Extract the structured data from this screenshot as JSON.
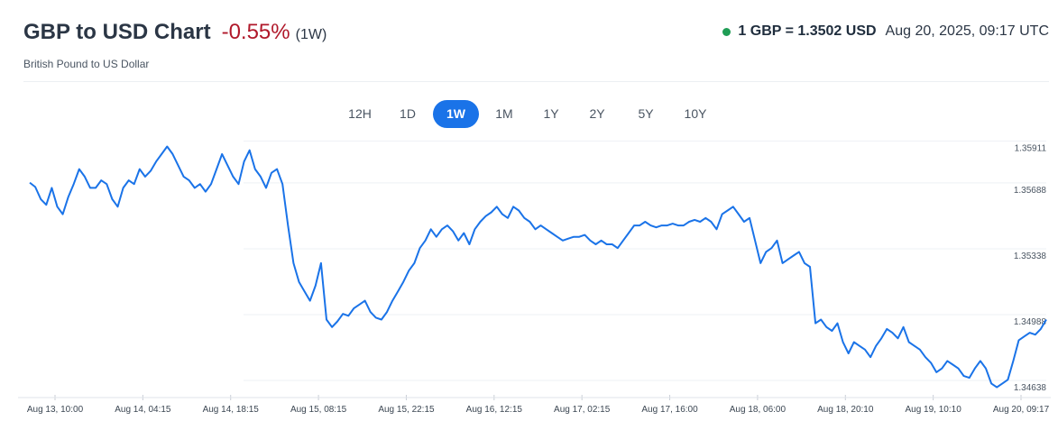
{
  "header": {
    "title": "GBP to USD Chart",
    "change": "-0.55%",
    "period": "(1W)",
    "subtitle": "British Pound to US Dollar",
    "rate": "1 GBP = 1.3502 USD",
    "timestamp": "Aug 20, 2025, 09:17 UTC",
    "status_color": "#1f9d55"
  },
  "tabs": [
    {
      "label": "12H",
      "active": false
    },
    {
      "label": "1D",
      "active": false
    },
    {
      "label": "1W",
      "active": true
    },
    {
      "label": "1M",
      "active": false
    },
    {
      "label": "1Y",
      "active": false
    },
    {
      "label": "2Y",
      "active": false
    },
    {
      "label": "5Y",
      "active": false
    },
    {
      "label": "10Y",
      "active": false
    }
  ],
  "chart_data": {
    "type": "line",
    "line_color": "#1a73e8",
    "y_ticks": [
      "1.35911",
      "1.35688",
      "1.35338",
      "1.34988",
      "1.34638"
    ],
    "y_tick_values": [
      1.35911,
      1.35688,
      1.35338,
      1.34988,
      1.34638
    ],
    "x_ticks": [
      "Aug 13, 10:00",
      "Aug 14, 04:15",
      "Aug 14, 18:15",
      "Aug 15, 08:15",
      "Aug 15, 22:15",
      "Aug 16, 12:15",
      "Aug 17, 02:15",
      "Aug 17, 16:00",
      "Aug 18, 06:00",
      "Aug 18, 20:10",
      "Aug 19, 10:10",
      "Aug 20, 09:17"
    ],
    "ylim": [
      1.3459,
      1.3598
    ],
    "series": [
      {
        "values": [
          1.35728,
          1.35705,
          1.3564,
          1.3561,
          1.357,
          1.356,
          1.3556,
          1.3565,
          1.3572,
          1.358,
          1.3576,
          1.357,
          1.357,
          1.3574,
          1.3572,
          1.3564,
          1.356,
          1.357,
          1.3574,
          1.3572,
          1.358,
          1.3576,
          1.3579,
          1.3584,
          1.3588,
          1.3592,
          1.3588,
          1.3582,
          1.3576,
          1.3574,
          1.357,
          1.3572,
          1.3568,
          1.3572,
          1.358,
          1.3588,
          1.3582,
          1.3576,
          1.3572,
          1.3584,
          1.359,
          1.358,
          1.3576,
          1.357,
          1.3578,
          1.358,
          1.3572,
          1.355,
          1.353,
          1.352,
          1.3515,
          1.351,
          1.3518,
          1.353,
          1.35,
          1.3496,
          1.3499,
          1.3503,
          1.3502,
          1.3506,
          1.3508,
          1.351,
          1.3504,
          1.3501,
          1.35,
          1.3504,
          1.351,
          1.3515,
          1.352,
          1.3526,
          1.353,
          1.3538,
          1.3542,
          1.3548,
          1.3544,
          1.3548,
          1.355,
          1.3547,
          1.3542,
          1.3546,
          1.354,
          1.3548,
          1.3552,
          1.3555,
          1.3557,
          1.356,
          1.3556,
          1.3554,
          1.356,
          1.3558,
          1.3554,
          1.3552,
          1.3548,
          1.355,
          1.3548,
          1.3546,
          1.3544,
          1.3542,
          1.3543,
          1.3544,
          1.3544,
          1.3545,
          1.3542,
          1.354,
          1.3542,
          1.354,
          1.354,
          1.3538,
          1.3542,
          1.3546,
          1.355,
          1.355,
          1.3552,
          1.355,
          1.3549,
          1.355,
          1.355,
          1.3551,
          1.355,
          1.355,
          1.3552,
          1.3553,
          1.3552,
          1.3554,
          1.3552,
          1.3548,
          1.3556,
          1.3558,
          1.356,
          1.3556,
          1.3552,
          1.3554,
          1.3542,
          1.353,
          1.3536,
          1.3538,
          1.3542,
          1.353,
          1.3532,
          1.3534,
          1.3536,
          1.353,
          1.3528,
          1.3498,
          1.35,
          1.3496,
          1.3494,
          1.3498,
          1.3488,
          1.3482,
          1.3488,
          1.3486,
          1.3484,
          1.348,
          1.3486,
          1.349,
          1.3495,
          1.3493,
          1.349,
          1.3496,
          1.3488,
          1.3486,
          1.3484,
          1.348,
          1.3477,
          1.3472,
          1.3474,
          1.3478,
          1.3476,
          1.3474,
          1.347,
          1.3469,
          1.3474,
          1.3478,
          1.3474,
          1.3466,
          1.3464,
          1.3466,
          1.3468,
          1.3478,
          1.3489,
          1.3491,
          1.3493,
          1.3492,
          1.3495,
          1.35
        ]
      }
    ]
  }
}
